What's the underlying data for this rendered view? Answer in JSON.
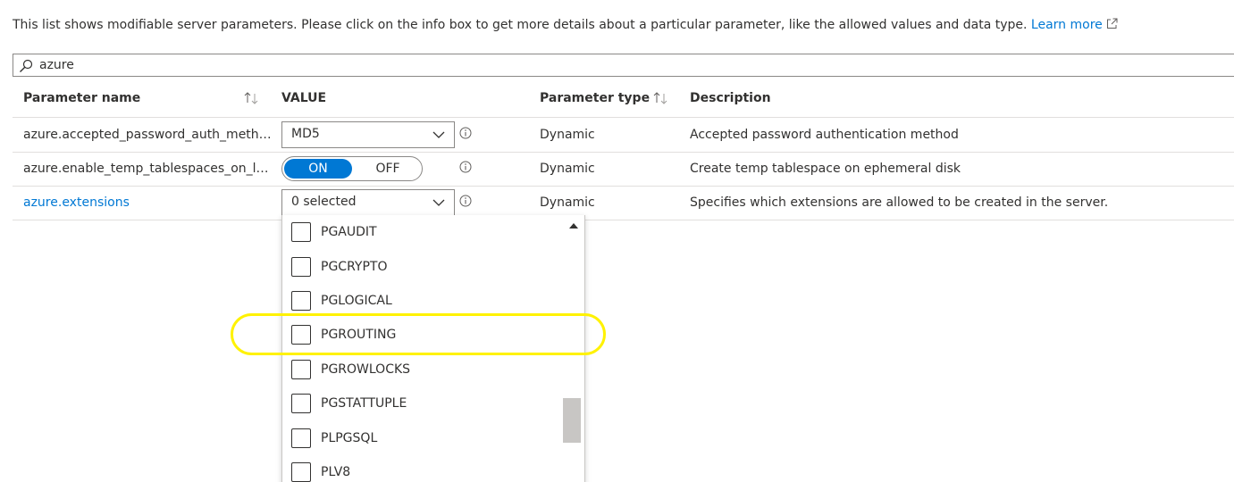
{
  "intro": {
    "text": "This list shows modifiable server parameters. Please click on the info box to get more details about a particular parameter, like the allowed values and data type.",
    "learn_more": "Learn more"
  },
  "search": {
    "value": "azure"
  },
  "columns": {
    "name": "Parameter name",
    "value": "VALUE",
    "type": "Parameter type",
    "description": "Description"
  },
  "rows": [
    {
      "name": "azure.accepted_password_auth_method",
      "value": "MD5",
      "type": "Dynamic",
      "description": "Accepted password authentication method"
    },
    {
      "name": "azure.enable_temp_tablespaces_on_lo...",
      "toggle_on": "ON",
      "toggle_off": "OFF",
      "selected": "ON",
      "type": "Dynamic",
      "description": "Create temp tablespace on ephemeral disk"
    },
    {
      "name": "azure.extensions",
      "value": "0 selected",
      "type": "Dynamic",
      "description": "Specifies which extensions are allowed to be created in the server."
    }
  ],
  "extensions_options": [
    "PGAUDIT",
    "PGCRYPTO",
    "PGLOGICAL",
    "PGROUTING",
    "PGROWLOCKS",
    "PGSTATTUPLE",
    "PLPGSQL",
    "PLV8"
  ],
  "colors": {
    "link": "#0078d4",
    "toggle_on": "#0078d4",
    "highlight": "#fff200",
    "border": "#8a8886",
    "divider": "#e1dfdd"
  }
}
